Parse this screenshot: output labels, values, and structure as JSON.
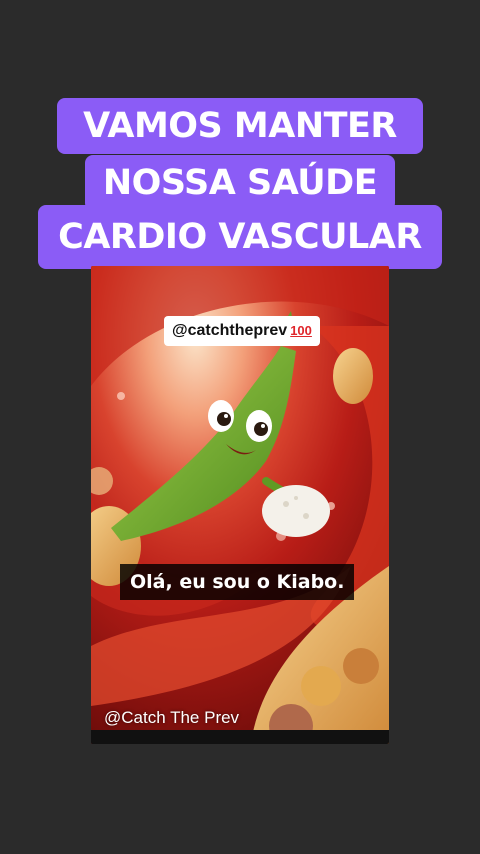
{
  "headline": {
    "line1": "VAMOS MANTER",
    "line2": "NOSSA SAÚDE",
    "line3": "CARDIO VASCULAR"
  },
  "video": {
    "handle_badge": "@catchtheprev",
    "handle_emoji": "100",
    "subtitle": "Olá, eu sou o Kiabo.",
    "watermark": "@Catch The Prev"
  },
  "colors": {
    "background": "#2b2b2b",
    "headline_bg": "#8b5cf6",
    "headline_text": "#ffffff"
  }
}
